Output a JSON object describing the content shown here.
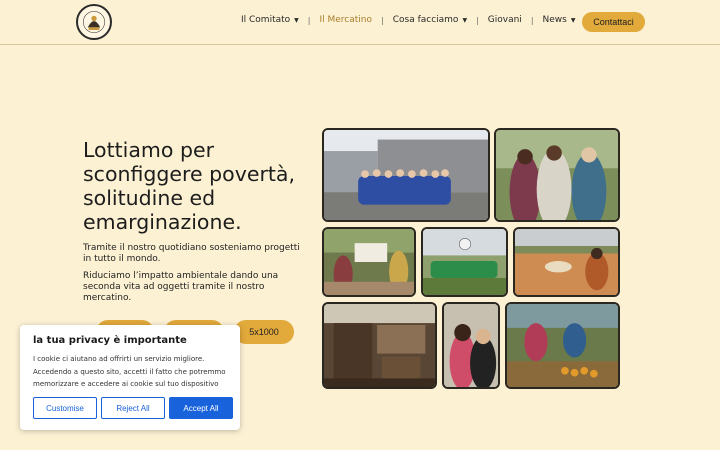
{
  "header": {
    "logo_alt": "COMITATO PER LA LOTTA CONTRO LA FAME NEL MONDO",
    "nav": [
      {
        "label": "Il Comitato",
        "dropdown": true,
        "active": false
      },
      {
        "label": "Il Mercatino",
        "dropdown": false,
        "active": true
      },
      {
        "label": "Cosa facciamo",
        "dropdown": true,
        "active": false
      },
      {
        "label": "Giovani",
        "dropdown": false,
        "active": false
      },
      {
        "label": "News",
        "dropdown": true,
        "active": false
      }
    ],
    "contact_label": "Contattaci"
  },
  "hero": {
    "title": "Lottiamo per sconfiggere povertà, solitudine ed emarginazione.",
    "paragraph1": "Tramite il nostro quotidiano sosteniamo progetti in tutto il mondo.",
    "paragraph2": "Riduciamo l’impatto ambientale dando una seconda vita ad oggetti tramite il nostro mercatino.",
    "button3_label": "5x1000"
  },
  "cookie": {
    "title": "la tua privacy è importante",
    "text": "I cookie ci aiutano ad offrirti un servizio migliore. Accedendo a questo sito, accetti il fatto che potremmo memorizzare e accedere ai cookie sul tuo dispositivo",
    "customise_label": "Customise",
    "reject_label": "Reject All",
    "accept_label": "Accept All"
  },
  "colors": {
    "background": "#fdf1d4",
    "accent": "#e2a93b",
    "active_nav": "#a87f2c",
    "cookie_primary": "#1863dc"
  },
  "icons": {
    "dropdown": "caret-down-icon"
  }
}
